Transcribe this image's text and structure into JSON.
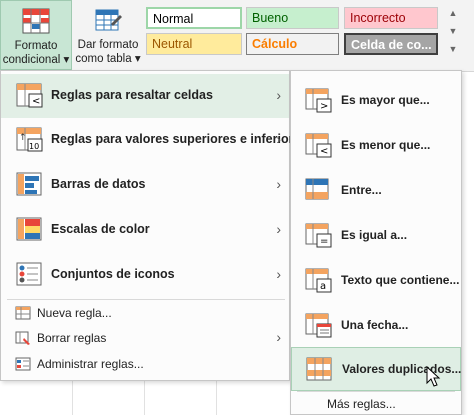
{
  "ribbon": {
    "formato_condicional": {
      "line1": "Formato",
      "line2": "condicional",
      "caret": "▾"
    },
    "dar_formato_tabla": {
      "line1": "Dar formato",
      "line2": "como tabla",
      "caret": "▾"
    },
    "styles": {
      "normal": "Normal",
      "bueno": "Bueno",
      "incorrecto": "Incorrecto",
      "neutral": "Neutral",
      "calculo": "Cálculo",
      "celda": "Celda de co..."
    }
  },
  "main_menu": {
    "items": [
      {
        "label": "Reglas para resaltar celdas",
        "icon": "highlight-cells-rules-icon",
        "has_submenu": true,
        "highlighted": true
      },
      {
        "label": "Reglas para valores superiores e inferiores",
        "icon": "top-bottom-rules-icon",
        "has_submenu": true,
        "highlighted": false
      },
      {
        "label": "Barras de datos",
        "icon": "data-bars-icon",
        "has_submenu": true,
        "highlighted": false
      },
      {
        "label": "Escalas de color",
        "icon": "color-scales-icon",
        "has_submenu": true,
        "highlighted": false
      },
      {
        "label": "Conjuntos de iconos",
        "icon": "icon-sets-icon",
        "has_submenu": true,
        "highlighted": false
      }
    ],
    "small_items": [
      {
        "label": "Nueva regla...",
        "icon": "new-rule-icon"
      },
      {
        "label": "Borrar reglas",
        "icon": "clear-rules-icon",
        "has_submenu": true
      },
      {
        "label": "Administrar reglas...",
        "icon": "manage-rules-icon"
      }
    ],
    "arrow": "›"
  },
  "sub_menu": {
    "items": [
      {
        "label": "Es mayor que...",
        "icon": "greater-than-icon"
      },
      {
        "label": "Es menor que...",
        "icon": "less-than-icon"
      },
      {
        "label": "Entre...",
        "icon": "between-icon"
      },
      {
        "label": "Es igual a...",
        "icon": "equal-to-icon"
      },
      {
        "label": "Texto que contiene...",
        "icon": "text-contains-icon"
      },
      {
        "label": "Una fecha...",
        "icon": "date-occurring-icon"
      },
      {
        "label": "Valores duplicados...",
        "icon": "duplicate-values-icon",
        "highlighted": true
      }
    ],
    "more": "Más reglas..."
  },
  "colors": {
    "accent_green": "#c8e6d4",
    "highlight": "#e2efe6",
    "icon_red": "#e8463a",
    "icon_blue": "#2e75b6",
    "icon_orange": "#f4a460"
  }
}
